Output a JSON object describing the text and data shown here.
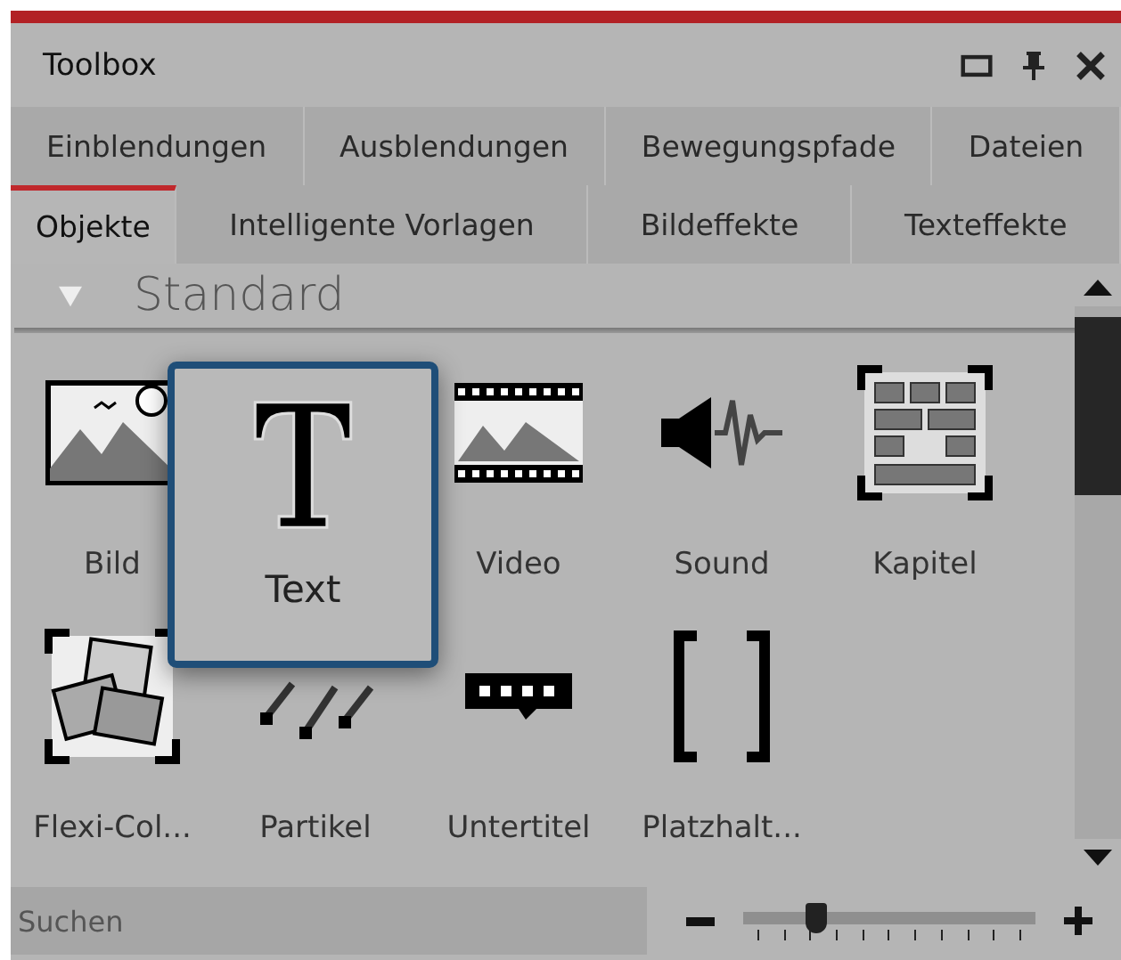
{
  "window": {
    "title": "Toolbox"
  },
  "tab_rows": [
    {
      "tabs": [
        {
          "label": "Einblendungen",
          "selected": false
        },
        {
          "label": "Ausblendungen",
          "selected": false
        },
        {
          "label": "Bewegungspfade",
          "selected": false
        },
        {
          "label": "Dateien",
          "selected": false
        }
      ]
    },
    {
      "tabs": [
        {
          "label": "Objekte",
          "selected": true
        },
        {
          "label": "Intelligente Vorlagen",
          "selected": false
        },
        {
          "label": "Bildeffekte",
          "selected": false
        },
        {
          "label": "Texteffekte",
          "selected": false
        }
      ]
    }
  ],
  "section": {
    "title": "Standard",
    "expanded": true
  },
  "items": [
    {
      "label": "Bild",
      "hovered": false
    },
    {
      "label": "Text",
      "hovered": true
    },
    {
      "label": "Video",
      "hovered": false
    },
    {
      "label": "Sound",
      "hovered": false
    },
    {
      "label": "Kapitel",
      "hovered": false
    },
    {
      "label": "Flexi-Col...",
      "hovered": false
    },
    {
      "label": "Partikel",
      "hovered": false
    },
    {
      "label": "Untertitel",
      "hovered": false
    },
    {
      "label": "Platzhalt...",
      "hovered": false
    }
  ],
  "search": {
    "placeholder": "Suchen"
  },
  "zoom_slider": {
    "level": 0.25
  }
}
